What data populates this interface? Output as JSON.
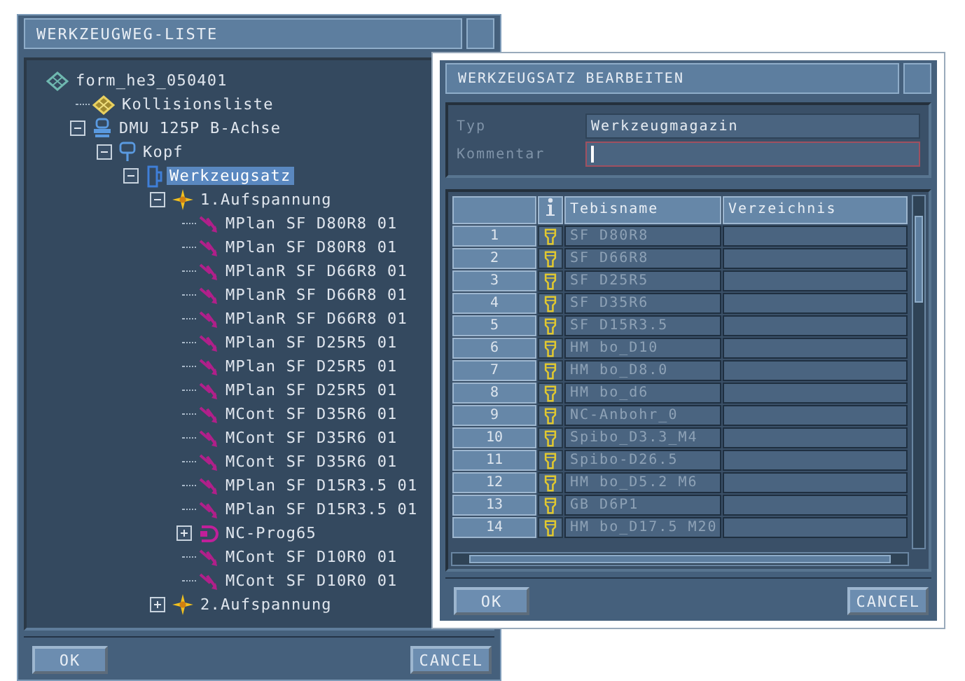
{
  "toolpath_window": {
    "title": "WERKZEUGWEG-LISTE",
    "tree": [
      {
        "label": "form_he3_050401",
        "kind": "project",
        "selected": false,
        "children": [
          {
            "label": "Kollisionsliste",
            "kind": "collision-list",
            "selected": false
          },
          {
            "label": "DMU 125P B-Achse",
            "kind": "machine",
            "selected": false,
            "expanded": true,
            "children": [
              {
                "label": "Kopf",
                "kind": "head",
                "selected": false,
                "expanded": true,
                "children": [
                  {
                    "label": "Werkzeugsatz",
                    "kind": "toolset",
                    "selected": true,
                    "expanded": true,
                    "children": [
                      {
                        "label": "1.Aufspannung",
                        "kind": "setup",
                        "selected": false,
                        "expanded": true,
                        "children": [
                          {
                            "label": "MPlan SF D80R8 01",
                            "kind": "toolpath",
                            "selected": false
                          },
                          {
                            "label": "MPlan SF D80R8 01",
                            "kind": "toolpath",
                            "selected": false
                          },
                          {
                            "label": "MPlanR SF D66R8 01",
                            "kind": "toolpath",
                            "selected": false
                          },
                          {
                            "label": "MPlanR SF D66R8 01",
                            "kind": "toolpath",
                            "selected": false
                          },
                          {
                            "label": "MPlanR SF D66R8 01",
                            "kind": "toolpath",
                            "selected": false
                          },
                          {
                            "label": "MPlan SF D25R5 01",
                            "kind": "toolpath",
                            "selected": false
                          },
                          {
                            "label": "MPlan SF D25R5 01",
                            "kind": "toolpath",
                            "selected": false
                          },
                          {
                            "label": "MPlan SF D25R5 01",
                            "kind": "toolpath",
                            "selected": false
                          },
                          {
                            "label": "MCont SF D35R6 01",
                            "kind": "toolpath",
                            "selected": false
                          },
                          {
                            "label": "MCont SF D35R6 01",
                            "kind": "toolpath",
                            "selected": false
                          },
                          {
                            "label": "MCont SF D35R6 01",
                            "kind": "toolpath",
                            "selected": false
                          },
                          {
                            "label": "MPlan SF D15R3.5 01",
                            "kind": "toolpath",
                            "selected": false
                          },
                          {
                            "label": "MPlan SF D15R3.5 01",
                            "kind": "toolpath",
                            "selected": false
                          },
                          {
                            "label": "NC-Prog65",
                            "kind": "nc-program",
                            "selected": false,
                            "expanded": false
                          },
                          {
                            "label": "MCont SF D10R0 01",
                            "kind": "toolpath",
                            "selected": false
                          },
                          {
                            "label": "MCont SF D10R0 01",
                            "kind": "toolpath",
                            "selected": false
                          }
                        ]
                      },
                      {
                        "label": "2.Aufspannung",
                        "kind": "setup",
                        "selected": false,
                        "expanded": false
                      }
                    ]
                  }
                ]
              }
            ]
          }
        ]
      }
    ],
    "buttons": [
      {
        "label": "OK"
      },
      {
        "label": "CANCEL"
      }
    ]
  },
  "toolset_dialog": {
    "title": "WERKZEUGSATZ BEARBEITEN",
    "fields": [
      {
        "label": "Typ",
        "value": "Werkzeugmagazin",
        "focused": false
      },
      {
        "label": "Kommentar",
        "focused": true
      }
    ],
    "table": {
      "columns": [
        "Tebisname",
        "Verzeichnis"
      ],
      "rows": [
        {
          "number": "1",
          "name": "SF D80R8"
        },
        {
          "number": "2",
          "name": "SF D66R8"
        },
        {
          "number": "3",
          "name": "SF D25R5"
        },
        {
          "number": "4",
          "name": "SF D35R6"
        },
        {
          "number": "5",
          "name": "SF D15R3.5"
        },
        {
          "number": "6",
          "name": "HM bo_D10"
        },
        {
          "number": "7",
          "name": "HM bo_D8.0"
        },
        {
          "number": "8",
          "name": "HM bo_d6"
        },
        {
          "number": "9",
          "name": "NC-Anbohr_0"
        },
        {
          "number": "10",
          "name": "Spibo_D3.3_M4"
        },
        {
          "number": "11",
          "name": "Spibo-D26.5"
        },
        {
          "number": "12",
          "name": "HM bo_D5.2 M6"
        },
        {
          "number": "13",
          "name": "GB D6P1"
        },
        {
          "number": "14",
          "name": "HM bo_D17.5 M20"
        }
      ]
    },
    "buttons": [
      {
        "label": "OK"
      },
      {
        "label": "CANCEL"
      }
    ]
  }
}
